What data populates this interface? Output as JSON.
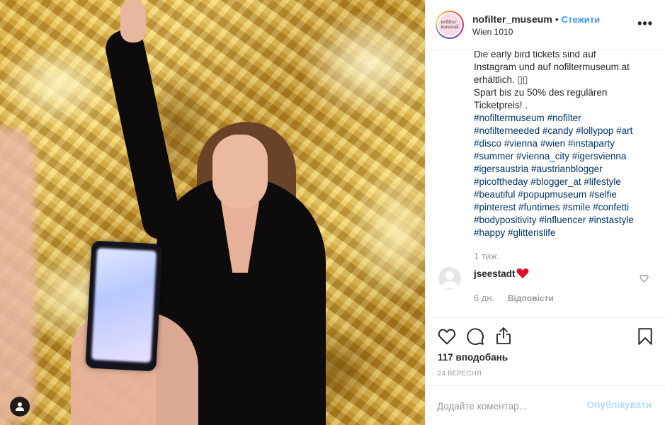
{
  "header": {
    "avatar_text": "nofilter_ museum",
    "username": "nofilter_museum",
    "separator": "•",
    "follow_label": "Стежити",
    "location": "Wien 1010",
    "more_label": "•••"
  },
  "caption": {
    "text": "Die early bird tickets sind auf\nInstagram und auf nofiltermuseum.at\nerhältlich. ▯▯\nSpart bis zu 50% des regulären\nTicketpreis! .",
    "hashtags": "#nofiltermuseum #nofilter\n#nofilterneeded #candy #lollypop #art\n#disco #vienna #wien #instaparty\n#summer #vienna_city #igersvienna\n#igersaustria #austrianblogger\n#picoftheday #blogger_at #lifestyle\n#beautiful #popupmuseum #selfie\n#pinterest #funtimes #smile #confetti\n#bodypositivity #influencer #instastyle\n#happy #glitterislife",
    "time": "1 тиж."
  },
  "comment": {
    "username": "jseestadt",
    "emoji_icon": "red-heart-emoji",
    "time": "6 дн.",
    "reply_label": "Відповісти"
  },
  "actions": {
    "likes": "117 вподобань",
    "date": "24 ВЕРЕСНЯ"
  },
  "add_comment": {
    "placeholder": "Додайте коментар...",
    "publish_label": "Опублікувати"
  },
  "colors": {
    "link_blue": "#3897f0",
    "hashtag_blue": "#003569",
    "muted_gray": "#999999",
    "publish_disabled": "#b2dffc",
    "heart_red": "#ed4956"
  }
}
